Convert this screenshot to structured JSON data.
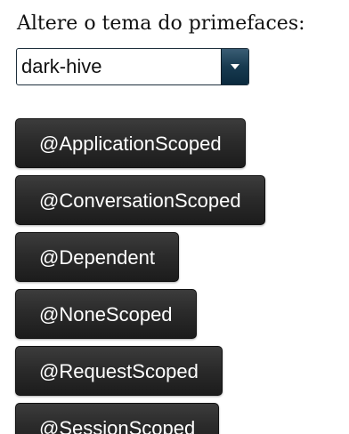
{
  "theme": {
    "label": "Altere o tema do primefaces:",
    "selected": "dark-hive",
    "accent": "#173a50"
  },
  "scopes": [
    {
      "label": "@ApplicationScoped"
    },
    {
      "label": "@ConversationScoped"
    },
    {
      "label": "@Dependent"
    },
    {
      "label": "@NoneScoped"
    },
    {
      "label": "@RequestScoped"
    },
    {
      "label": "@SessionScoped"
    }
  ],
  "icons": {
    "dropdown": "chevron-down-icon"
  },
  "colors": {
    "button_bg": "#2b2b2b",
    "button_text": "#ffffff"
  }
}
